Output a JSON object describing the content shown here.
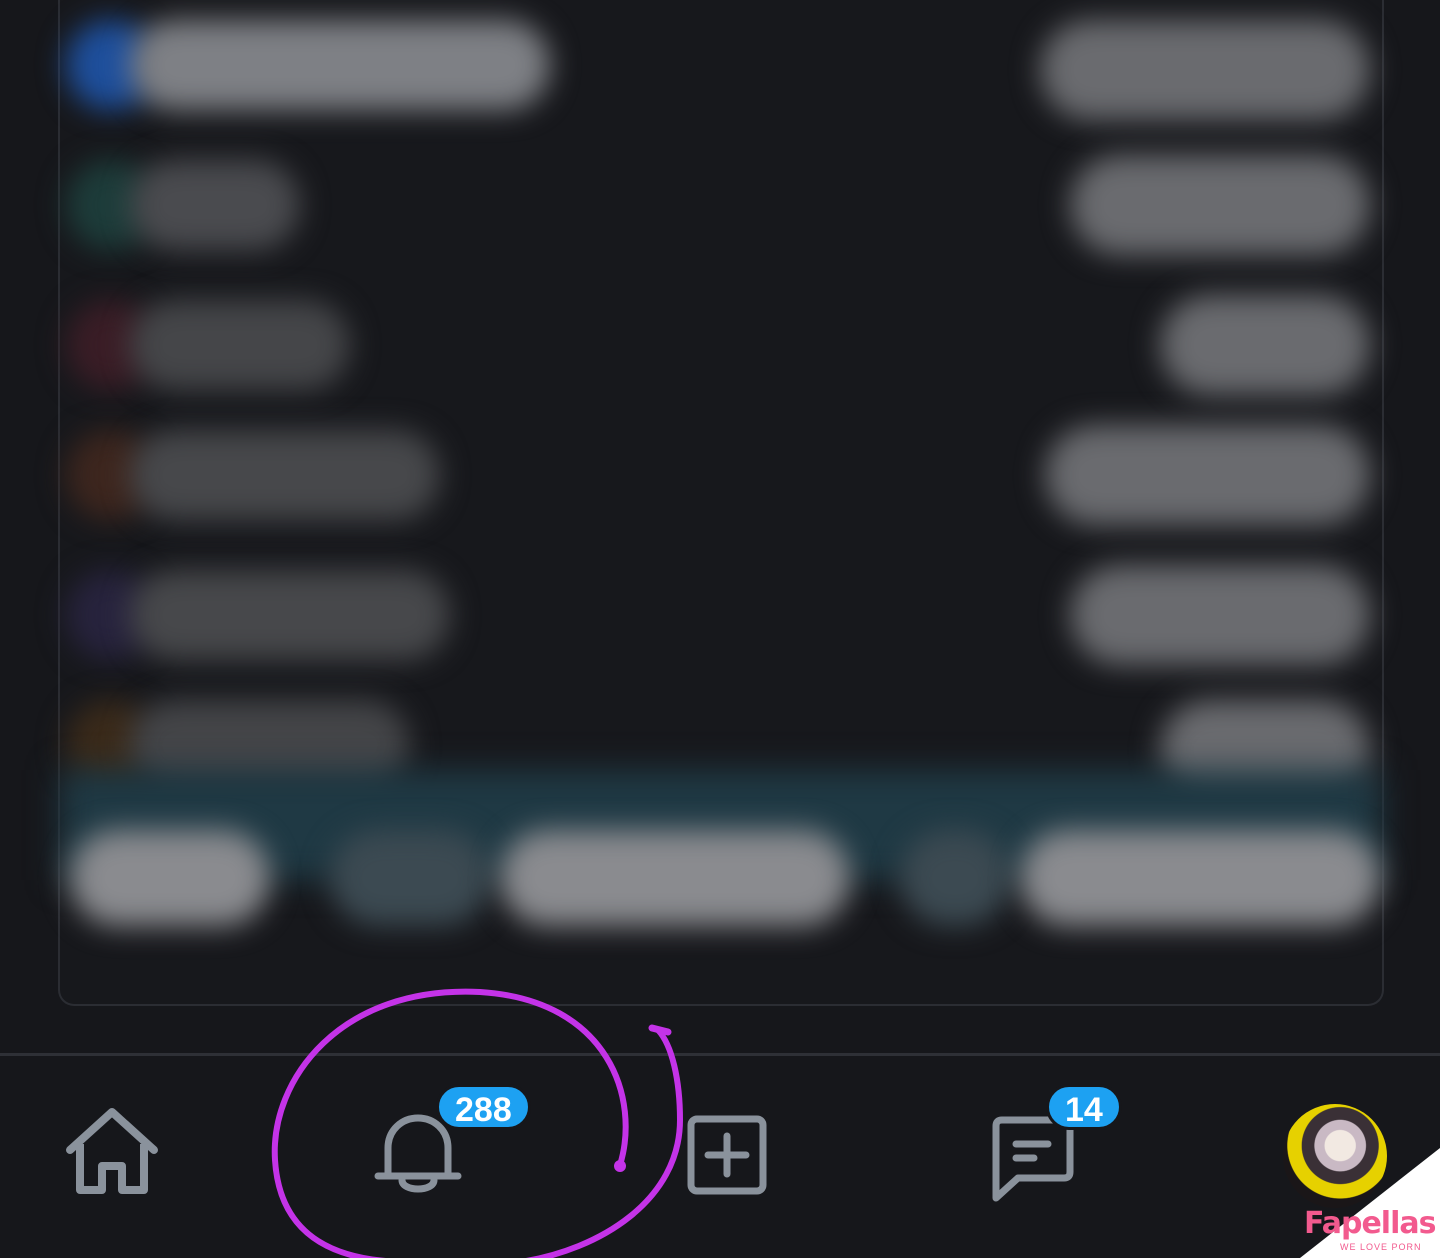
{
  "nav": {
    "home": {
      "icon": "home-icon"
    },
    "notifications": {
      "icon": "bell-icon",
      "badge": "288"
    },
    "create": {
      "icon": "plus-square-icon"
    },
    "messages": {
      "icon": "message-icon",
      "badge": "14"
    },
    "profile": {
      "icon": "avatar"
    }
  },
  "colors": {
    "background": "#16171b",
    "icon": "#8a929c",
    "badge": "#1da1f2",
    "annotation": "#c433e8"
  },
  "watermark": {
    "name": "Fapellas",
    "tagline": "WE LOVE PORN"
  }
}
